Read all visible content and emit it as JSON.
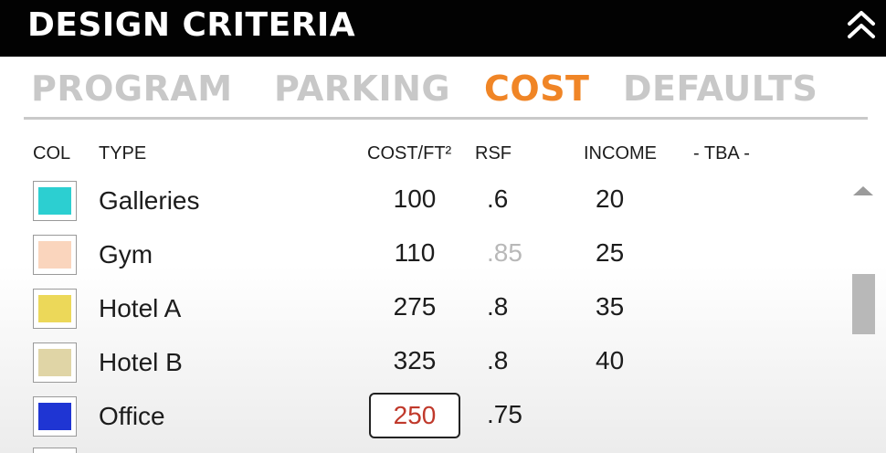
{
  "header": {
    "title": "DESIGN CRITERIA",
    "collapse_icon": "double-chevron-up-icon"
  },
  "tabs": [
    {
      "label": "PROGRAM",
      "active": false
    },
    {
      "label": "PARKING",
      "active": false
    },
    {
      "label": "COST",
      "active": true
    },
    {
      "label": "DEFAULTS",
      "active": false
    }
  ],
  "columns": {
    "col": "COL",
    "type": "TYPE",
    "cost": "COST/FT²",
    "rsf": "RSF",
    "income": "INCOME",
    "tba": "- TBA -"
  },
  "rows": [
    {
      "type": "Galleries",
      "color": "#2ccfd1",
      "cost": "100",
      "rsf": ".6",
      "income": "20"
    },
    {
      "type": "Gym",
      "color": "#fad5bd",
      "cost": "110",
      "rsf": ".85",
      "income": "25",
      "rsf_faded": true
    },
    {
      "type": "Hotel A",
      "color": "#ecd859",
      "cost": "275",
      "rsf": ".8",
      "income": "35"
    },
    {
      "type": "Hotel B",
      "color": "#e0d5a6",
      "cost": "325",
      "rsf": ".8",
      "income": "40"
    },
    {
      "type": "Office",
      "color": "#1f35d3",
      "cost": "250",
      "rsf": ".75",
      "income": "",
      "cost_editing": true
    }
  ],
  "colors": {
    "accent": "#f08526",
    "edit_text": "#c0392b",
    "tab_inactive": "#c8c8c8"
  }
}
